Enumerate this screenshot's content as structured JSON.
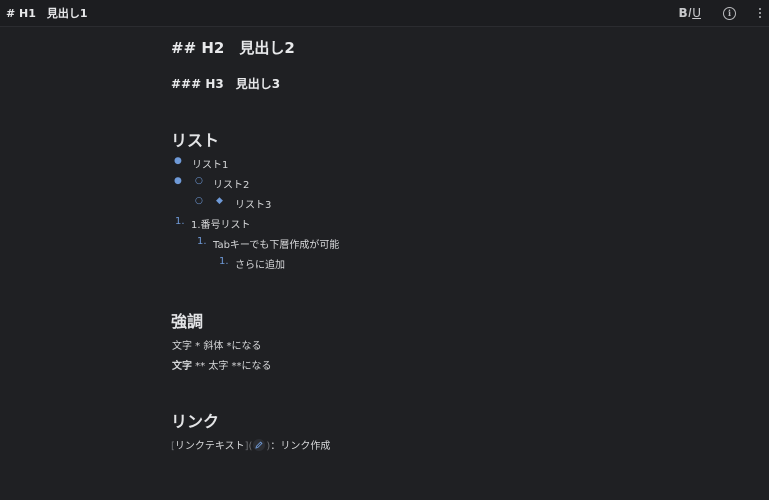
{
  "header": {
    "title": "# H1　見出し1",
    "format_bold": "B",
    "format_italic": "I",
    "format_underline": "U",
    "info_icon": "info-icon",
    "more_icon": "kebab-icon"
  },
  "doc": {
    "h2": "## H2　見出し2",
    "h3": "### H3　見出し3",
    "list_section": "リスト",
    "bullets": {
      "b1": "リスト1",
      "b2": "リスト2",
      "b3": "リスト3"
    },
    "numbered": {
      "n1_marker": "1.",
      "n1": "1.番号リスト",
      "n2_marker": "1.",
      "n2": "Tabキーでも下層作成が可能",
      "n3_marker": "1.",
      "n3": "さらに追加"
    },
    "emphasis_section": "強調",
    "italic_line": "文字 * 斜体 *になる",
    "bold_prefix": "文字",
    "bold_rest": " ** 太字 **になる",
    "link_section": "リンク",
    "link_open": "[",
    "link_text": "リンクテキスト",
    "link_mid": "](",
    "link_close": ")",
    "link_desc": "：リンク作成"
  },
  "colors": {
    "background": "#1f2023",
    "accent": "#6f9ad8"
  }
}
